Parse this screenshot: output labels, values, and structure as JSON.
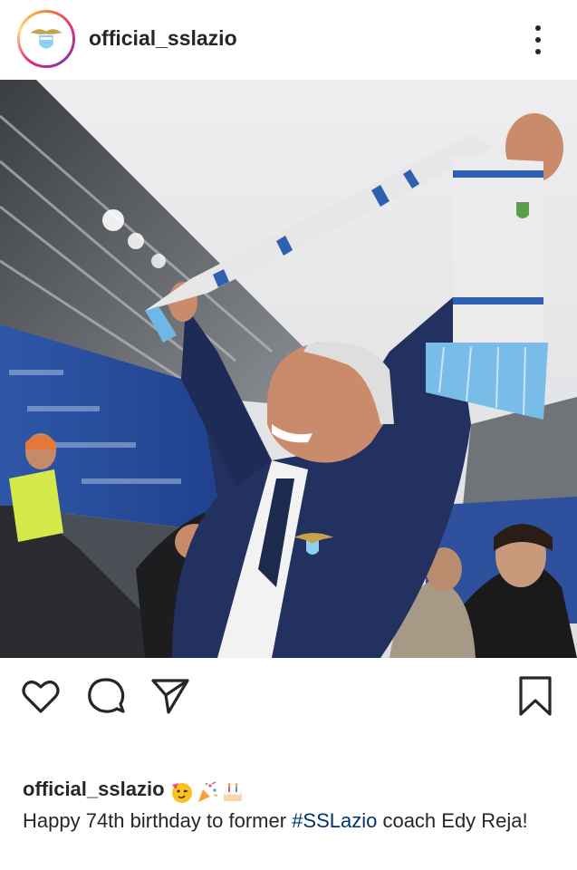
{
  "post": {
    "username": "official_sslazio",
    "caption": {
      "username": "official_sslazio",
      "text_before": "Happy 74th birthday to former ",
      "hashtag": "#SSLazio",
      "text_after": " coach Edy Reja!",
      "emojis": [
        "partying-face-emoji",
        "party-popper-emoji",
        "birthday-cake-emoji"
      ]
    }
  },
  "icons": {
    "more": "more-vertical-icon",
    "like": "heart-icon",
    "comment": "comment-icon",
    "share": "send-icon",
    "save": "bookmark-icon"
  },
  "colors": {
    "text": "#262626",
    "hashtag": "#003569",
    "lazio_blue": "#87c7ec",
    "lazio_navy": "#1c2a5a"
  }
}
